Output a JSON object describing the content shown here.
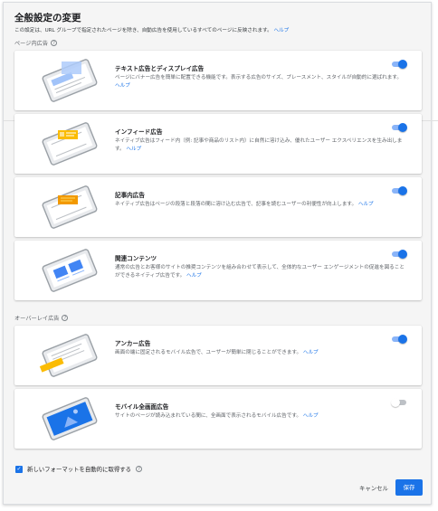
{
  "dialog": {
    "title": "全般設定の変更",
    "subtitle": "この設定は、URL グループで指定されたページを除き、自動広告を使用しているすべてのページに反映されます。",
    "subtitle_link": "ヘルプ"
  },
  "sections": {
    "in_page_label": "ページ内広告",
    "overlay_label": "オーバーレイ広告"
  },
  "cards": [
    {
      "title": "テキスト広告とディスプレイ広告",
      "desc": "ページにバナー広告を簡単に配置できる機能です。表示する広告のサイズ、プレースメント、スタイルが自動的に選ばれます。",
      "link": "ヘルプ",
      "enabled": true
    },
    {
      "title": "インフィード広告",
      "desc": "ネイティブ広告はフィード内（例: 記事や商品のリスト内）に自然に溶け込み、優れたユーザー エクスペリエンスを生み出します。",
      "link": "ヘルプ",
      "enabled": true
    },
    {
      "title": "記事内広告",
      "desc": "ネイティブ広告はページの段落と段落の間に溶け込む広告で、記事を読むユーザーの利便性が向上します。",
      "link": "ヘルプ",
      "enabled": true
    },
    {
      "title": "関連コンテンツ",
      "desc": "通常の広告とお客様のサイトの推奨コンテンツを組み合わせて表示して、全体的なユーザー エンゲージメントの促進を図ることができるネイティブ広告です。",
      "link": "ヘルプ",
      "enabled": true
    },
    {
      "title": "アンカー広告",
      "desc": "画面の端に固定されるモバイル広告で、ユーザーが簡単に閉じることができます。",
      "link": "ヘルプ",
      "enabled": true
    },
    {
      "title": "モバイル全画面広告",
      "desc": "サイトのページが読み込まれている間に、全画面で表示されるモバイル広告です。",
      "link": "ヘルプ",
      "enabled": false
    }
  ],
  "footer": {
    "checkbox_label": "新しいフォーマットを自動的に取得する",
    "checkbox_checked": true,
    "cancel_label": "キャンセル",
    "save_label": "保存"
  },
  "colors": {
    "accent": "#1a73e8",
    "orange": "#fbbc04",
    "ad_orange": "#f29900"
  },
  "icons": [
    "help-circle-icon",
    "checkbox-checked-icon"
  ]
}
